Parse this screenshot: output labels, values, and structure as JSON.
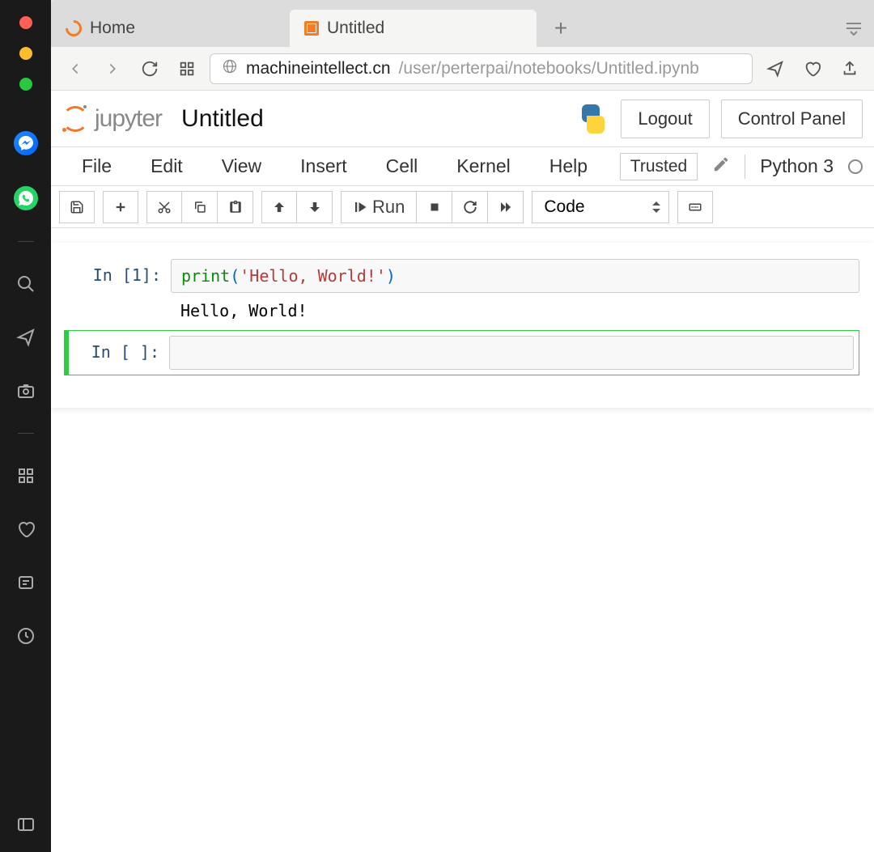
{
  "browser_tabs": {
    "home": "Home",
    "active": "Untitled"
  },
  "url": {
    "host": "machineintellect.cn",
    "path": "/user/perterpai/notebooks/Untitled.ipynb"
  },
  "jupyter": {
    "logo_text": "jupyter",
    "title": "Untitled",
    "logout": "Logout",
    "control_panel": "Control Panel"
  },
  "menu": {
    "file": "File",
    "edit": "Edit",
    "view": "View",
    "insert": "Insert",
    "cell": "Cell",
    "kernel": "Kernel",
    "help": "Help"
  },
  "status": {
    "trusted": "Trusted",
    "kernel": "Python 3"
  },
  "toolbar": {
    "run": "Run",
    "celltype": "Code"
  },
  "cells": {
    "c1_prompt": "In [1]:",
    "c1_fn": "print",
    "c1_open": "(",
    "c1_str": "'Hello, World!'",
    "c1_close": ")",
    "c1_output": "Hello, World!",
    "c2_prompt": "In [ ]:"
  }
}
